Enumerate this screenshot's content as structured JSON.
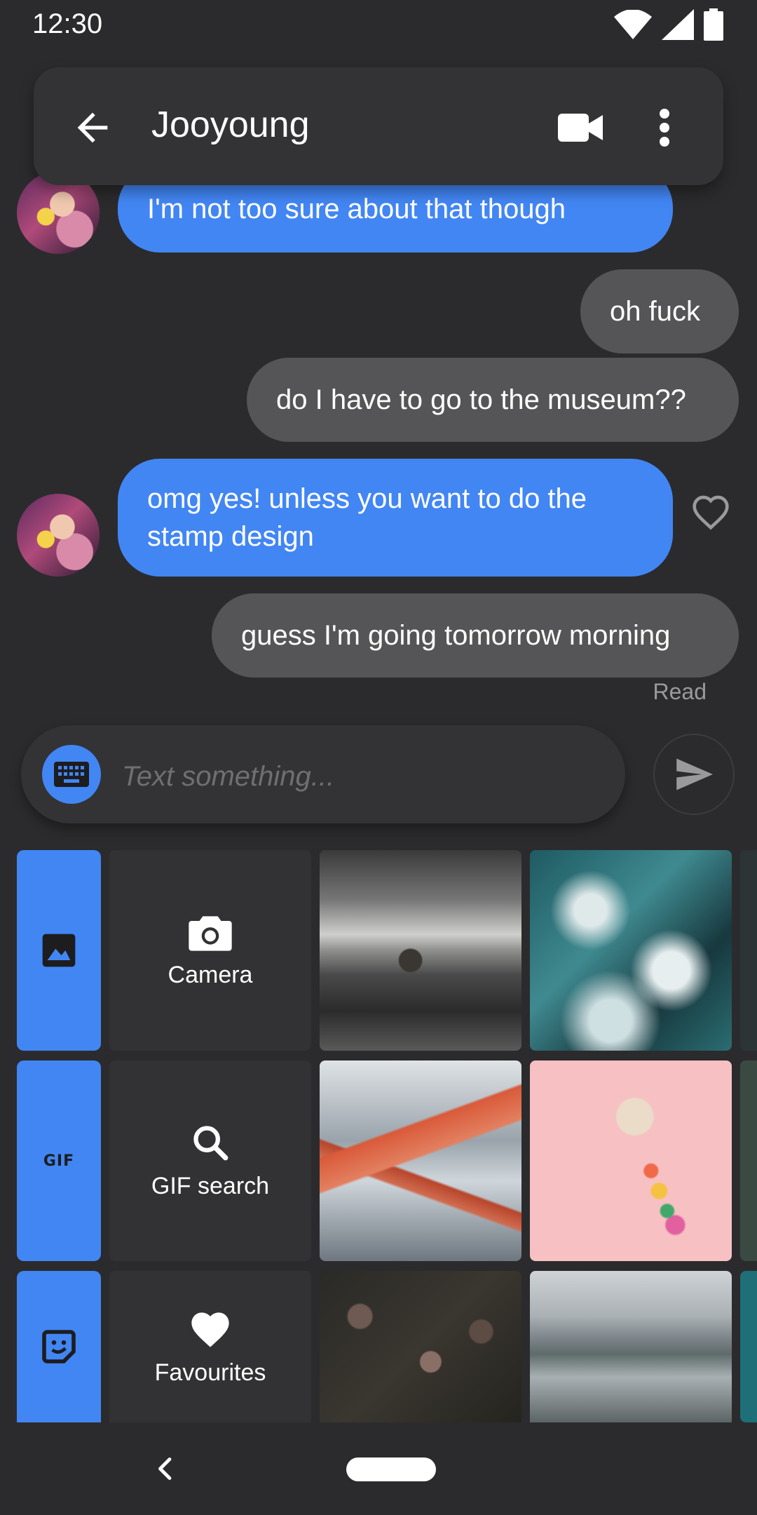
{
  "status_bar": {
    "time": "12:30"
  },
  "header": {
    "title": "Jooyoung"
  },
  "messages": [
    {
      "text": "I'm not too sure about that though",
      "direction": "incoming"
    },
    {
      "text": "oh fuck",
      "direction": "outgoing"
    },
    {
      "text": "do I have to go to the museum??",
      "direction": "outgoing"
    },
    {
      "text": "omg yes! unless you want to do the stamp design",
      "direction": "incoming"
    },
    {
      "text": "guess I'm going tomorrow morning",
      "direction": "outgoing"
    }
  ],
  "receipt": "Read",
  "compose": {
    "placeholder": "Text something..."
  },
  "tray": {
    "tab_gif": "GIF",
    "actions": {
      "camera": "Camera",
      "gif_search": "GIF search",
      "favourites": "Favourites"
    }
  },
  "icons": [
    "back-arrow-icon",
    "video-call-icon",
    "more-vert-icon",
    "heart-icon",
    "keyboard-icon",
    "send-icon",
    "image-icon",
    "sticker-icon",
    "camera-icon",
    "search-icon",
    "nav-back-icon"
  ],
  "colors": {
    "accent": "#4286f4",
    "background": "#2b2b2d",
    "outgoing_bubble": "#555557"
  }
}
